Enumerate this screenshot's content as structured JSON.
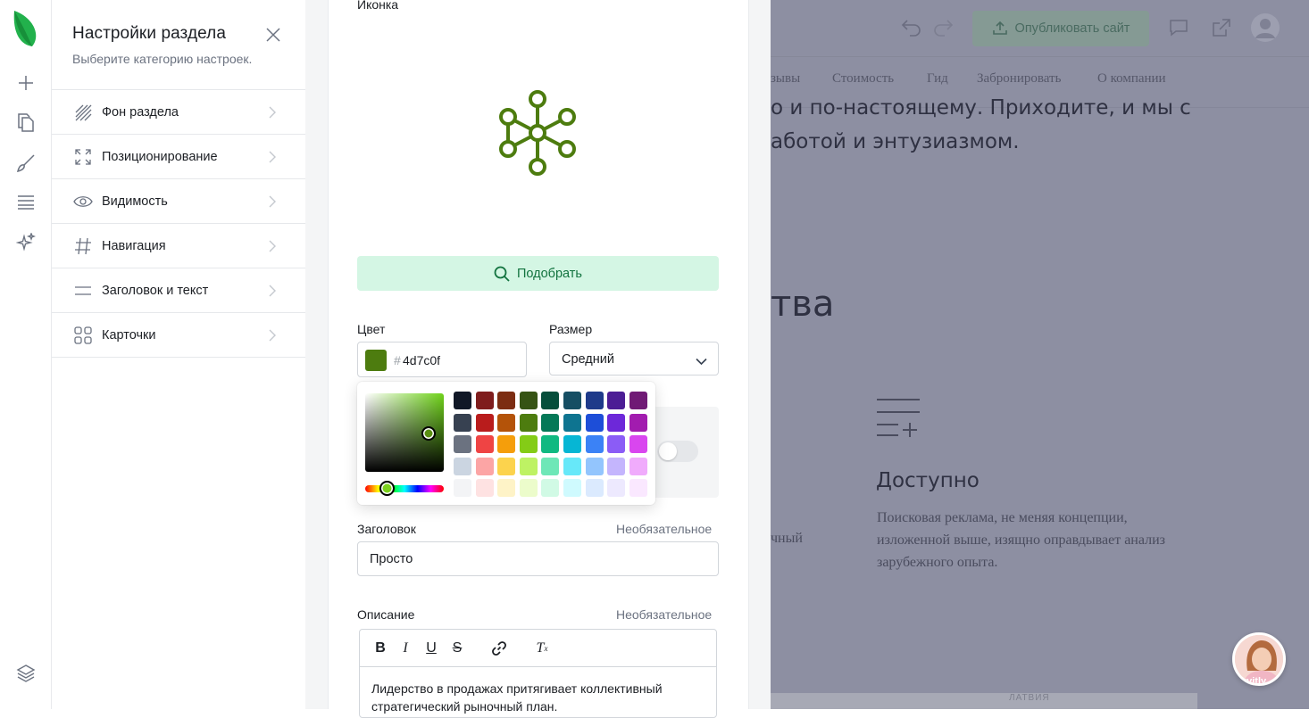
{
  "settings": {
    "title": "Настройки раздела",
    "subtitle": "Выберите категорию настроек.",
    "items": [
      {
        "label": "Фон раздела",
        "icon": "background-stripes-icon"
      },
      {
        "label": "Позиционирование",
        "icon": "expand-corners-icon"
      },
      {
        "label": "Видимость",
        "icon": "eye-icon"
      },
      {
        "label": "Навигация",
        "icon": "hash-icon"
      },
      {
        "label": "Заголовок и текст",
        "icon": "text-lines-icon"
      },
      {
        "label": "Карточки",
        "icon": "cards-grid-icon"
      }
    ]
  },
  "editor": {
    "icon_label": "Иконка",
    "icon_name": "network-hub-icon",
    "pick_button": "Подобрать",
    "color_label": "Цвет",
    "color_hash": "#",
    "color_value": "4d7c0f",
    "size_label": "Размер",
    "size_value": "Средний",
    "title_label": "Заголовок",
    "title_optional": "Необязательное",
    "title_value": "Просто",
    "description_label": "Описание",
    "description_optional": "Необязательное",
    "description_text": "Лидерство в продажах притягивает коллективный стратегический рыночный план."
  },
  "colors": {
    "accent": "#4d7c0f",
    "pick_button_bg": "#d4f6e4",
    "pick_button_text": "#12733f",
    "swatch_rows": [
      [
        "#111827",
        "#7f1d1d",
        "#7c2d12",
        "#365314",
        "#064e3b",
        "#164e63",
        "#1e3a8a",
        "#4c1d95",
        "#701a75"
      ],
      [
        "#374151",
        "#b91c1c",
        "#b45309",
        "#4d7c0f",
        "#047857",
        "#0e7490",
        "#1d4ed8",
        "#6d28d9",
        "#a21caf"
      ],
      [
        "#6b7280",
        "#ef4444",
        "#f59e0b",
        "#84cc16",
        "#10b981",
        "#06b6d4",
        "#3b82f6",
        "#8b5cf6",
        "#d946ef"
      ],
      [
        "#cbd5e1",
        "#fca5a5",
        "#fcd34d",
        "#bef264",
        "#6ee7b7",
        "#67e8f9",
        "#93c5fd",
        "#c4b5fd",
        "#f0abfc"
      ],
      [
        "#f3f4f6",
        "#fee2e2",
        "#fef3c7",
        "#ecfccb",
        "#d1fae5",
        "#cffafe",
        "#dbeafe",
        "#ede9fe",
        "#fae8ff"
      ]
    ]
  },
  "preview": {
    "publish_button": "Опубликовать сайт",
    "nav": [
      "зывы",
      "Стоимость",
      "Гид",
      "Забронировать",
      "О компании"
    ],
    "text_line1": "о и по-настоящему. Приходите, и мы с",
    "text_line2": "аботой и энтузиазмом.",
    "heading_fragment": "тва",
    "feature_title": "Доступно",
    "feature_text": "Поисковая реклама, не меняя концепции, изложенной выше, изящно оправдывает анализ зарубежного опыта.",
    "text_fragment": "чный",
    "map_label": "ЛАТВИЯ",
    "avatar_name": "kvitly"
  }
}
